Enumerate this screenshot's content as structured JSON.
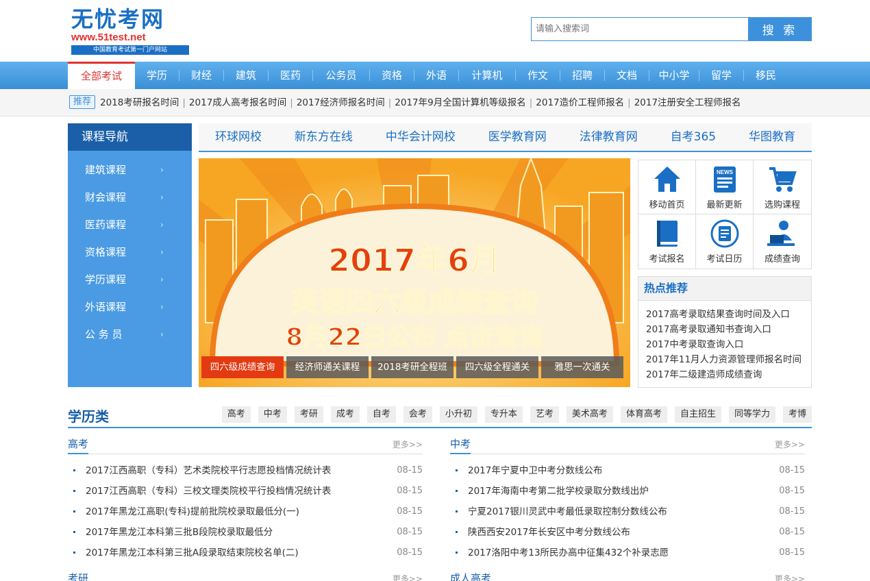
{
  "logo": {
    "main": "无忧考网",
    "url": "www.51test.net",
    "tagline": "中国教育考试第一门户网站"
  },
  "search": {
    "placeholder": "请输入搜索词",
    "button": "搜 索"
  },
  "nav": [
    "全部考试",
    "学历",
    "财经",
    "建筑",
    "医药",
    "公务员",
    "资格",
    "外语",
    "计算机",
    "作文",
    "招聘",
    "文档",
    "中小学",
    "留学",
    "移民"
  ],
  "recommend": {
    "tag": "推荐",
    "links": [
      "2018考研报名时间",
      "2017成人高考报名时间",
      "2017经济师报名时间",
      "2017年9月全国计算机等级报名",
      "2017造价工程师报名",
      "2017注册安全工程师报名"
    ],
    "separator": "|"
  },
  "sidebar": {
    "title": "课程导航",
    "items": [
      "建筑课程",
      "财会课程",
      "医药课程",
      "资格课程",
      "学历课程",
      "外语课程",
      "公 务 员"
    ],
    "arrow": "›"
  },
  "partners": [
    "环球网校",
    "新东方在线",
    "中华会计网校",
    "医学教育网",
    "法律教育网",
    "自考365",
    "华图教育"
  ],
  "banner": {
    "line1": "2017年6月",
    "line2": "英语四六级成绩查询",
    "line3": "8月22日公布 点击查询",
    "tabs": [
      "四六级成绩查询",
      "经济师通关课程",
      "2018考研全程班",
      "四六级全程通关",
      "雅思一次通关"
    ],
    "colors": {
      "bg": "#f6b736",
      "text": "#e3400f",
      "active_tab": "#e43a12"
    }
  },
  "quick_links": [
    {
      "label": "移动首页",
      "icon": "home-icon"
    },
    {
      "label": "最新更新",
      "icon": "news-icon"
    },
    {
      "label": "选购课程",
      "icon": "cart-icon"
    },
    {
      "label": "考试报名",
      "icon": "book-icon"
    },
    {
      "label": "考试日历",
      "icon": "calendar-doc-icon"
    },
    {
      "label": "成绩查询",
      "icon": "user-computer-icon"
    }
  ],
  "hot": {
    "title": "热点推荐",
    "items": [
      "2017高考录取结果查询时间及入口",
      "2017高考录取通知书查询入口",
      "2017中考录取查询入口",
      "2017年11月人力资源管理师报名时间",
      "2017年二级建造师成绩查询"
    ]
  },
  "education": {
    "title": "学历类",
    "tags": [
      "高考",
      "中考",
      "考研",
      "成考",
      "自考",
      "会考",
      "小升初",
      "专升本",
      "艺考",
      "美术高考",
      "体育高考",
      "自主招生",
      "同等学力",
      "考博"
    ],
    "more": "更多>>",
    "columns": [
      {
        "title": "高考",
        "items": [
          {
            "text": "2017江西高职（专科）艺术类院校平行志愿投档情况统计表",
            "date": "08-15"
          },
          {
            "text": "2017江西高职（专科）三校文理类院校平行投档情况统计表",
            "date": "08-15"
          },
          {
            "text": "2017年黑龙江高职(专科)提前批院校录取最低分(一)",
            "date": "08-15"
          },
          {
            "text": "2017年黑龙江本科第三批B段院校录取最低分",
            "date": "08-15"
          },
          {
            "text": "2017年黑龙江本科第三批A段录取结束院校名单(二)",
            "date": "08-15"
          }
        ]
      },
      {
        "title": "中考",
        "items": [
          {
            "text": "2017年宁夏中卫中考分数线公布",
            "date": "08-15"
          },
          {
            "text": "2017年海南中考第二批学校录取分数线出炉",
            "date": "08-15"
          },
          {
            "text": "宁夏2017银川灵武中考最低录取控制分数线公布",
            "date": "08-15"
          },
          {
            "text": "陕西西安2017年长安区中考分数线公布",
            "date": "08-15"
          },
          {
            "text": "2017洛阳中考13所民办高中征集432个补录志愿",
            "date": "08-15"
          }
        ]
      }
    ],
    "next_columns": [
      "考研",
      "成人高考"
    ]
  }
}
